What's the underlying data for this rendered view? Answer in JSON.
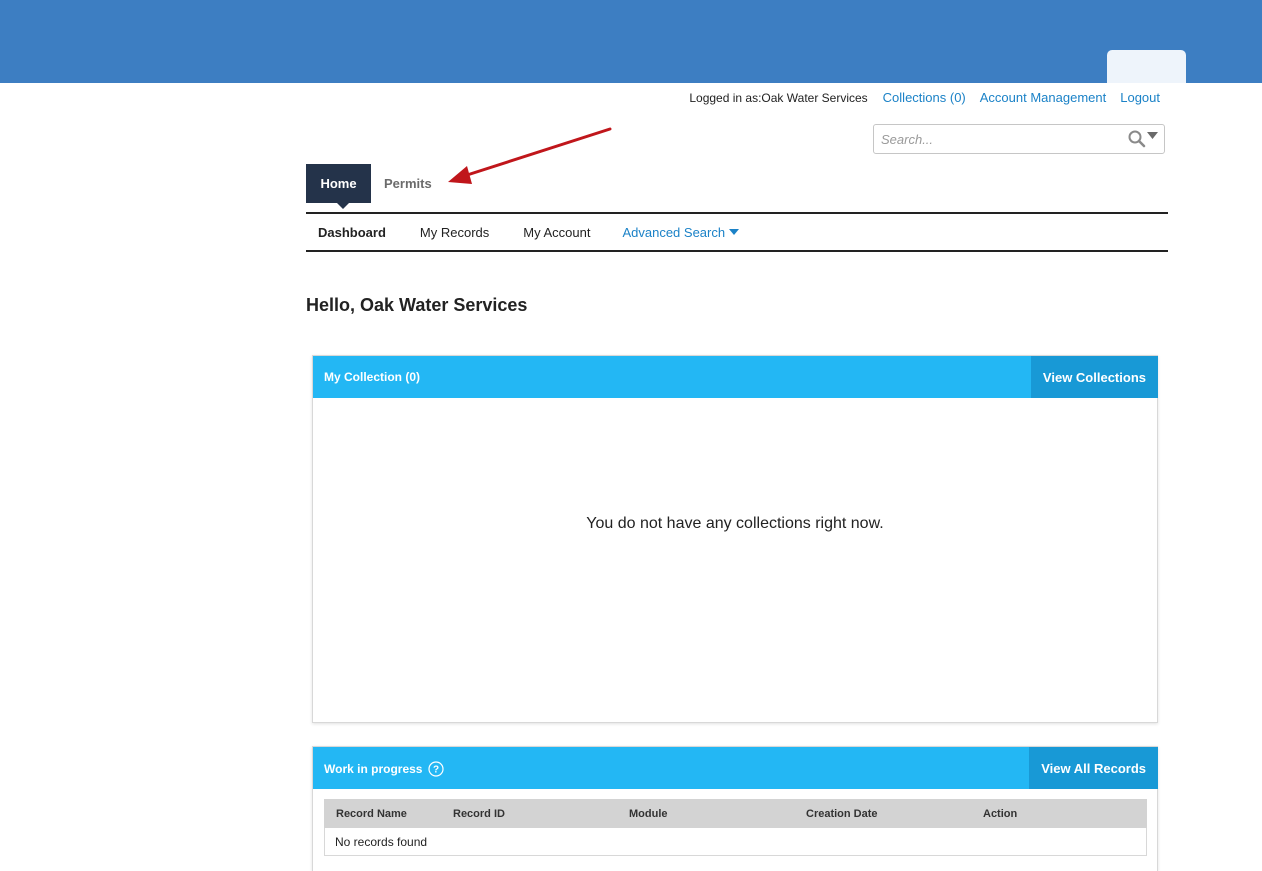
{
  "topbar": {
    "logged_in": "Logged in as:Oak Water Services",
    "collections_link": "Collections (0)",
    "account_link": "Account Management",
    "logout_link": "Logout"
  },
  "search": {
    "placeholder": "Search..."
  },
  "module_tabs": {
    "home": "Home",
    "permits": "Permits"
  },
  "subnav": {
    "dashboard": "Dashboard",
    "my_records": "My Records",
    "my_account": "My Account",
    "advanced_search": "Advanced Search"
  },
  "greeting": "Hello, Oak Water Services",
  "collection_panel": {
    "title": "My Collection (0)",
    "button": "View Collections",
    "empty_message": "You do not have any collections right now."
  },
  "wip_panel": {
    "title": "Work in progress",
    "button": "View All Records",
    "columns": [
      "Record Name",
      "Record ID",
      "Module",
      "Creation Date",
      "Action"
    ],
    "empty_message": "No records found"
  },
  "colors": {
    "banner": "#3d7ec2",
    "link": "#1b82c7",
    "panel_header": "#23b7f4",
    "panel_button": "#1899d6",
    "home_tab": "#24334a",
    "arrow": "#c0161b"
  },
  "icons": [
    "search-icon",
    "caret-down-icon",
    "help-icon",
    "annotation-arrow"
  ]
}
